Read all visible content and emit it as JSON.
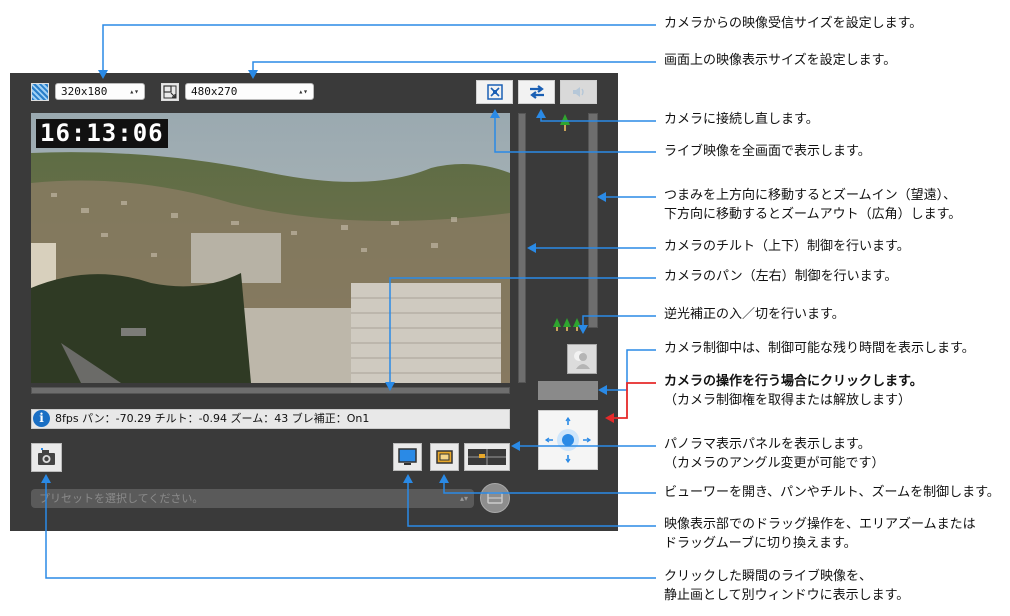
{
  "viewer": {
    "receive_size": "320x180",
    "display_size": "480x270",
    "timestamp": "16:13:06",
    "info_text": "8fps パン：-70.29 チルト：-0.94 ズーム：43 ブレ補正：On1",
    "preset_placeholder": "プリセットを選択してください。"
  },
  "annotations": {
    "receive_size": "カメラからの映像受信サイズを設定します。",
    "display_size": "画面上の映像表示サイズを設定します。",
    "reconnect": "カメラに接続し直します。",
    "fullscreen": "ライブ映像を全画面で表示します。",
    "zoom_line1": "つまみを上方向に移動するとズームイン（望遠）、",
    "zoom_line2": "下方向に移動するとズームアウト（広角）します。",
    "tilt": "カメラのチルト（上下）制御を行います。",
    "pan": "カメラのパン（左右）制御を行います。",
    "backlight": "逆光補正の入／切を行います。",
    "remaining_time": "カメラ制御中は、制御可能な残り時間を表示します。",
    "control_line1": "カメラの操作を行う場合にクリックします。",
    "control_line2": "（カメラ制御権を取得または解放します）",
    "panorama_line1": "パノラマ表示パネルを表示します。",
    "panorama_line2": "（カメラのアングル変更が可能です）",
    "viewer_line1": "ビューワーを開き、パンやチルト、ズームを制御します。",
    "drag_line1": "映像表示部でのドラッグ操作を、エリアズームまたは",
    "drag_line2": "ドラッグムーブに切り換えます。",
    "snapshot_line1": "クリックした瞬間のライブ映像を、",
    "snapshot_line2": "静止画として別ウィンドウに表示します。"
  },
  "colors": {
    "panel": "#3a3a3a",
    "annotation_line": "#2a8ae6",
    "control_line": "#e62a2a"
  }
}
